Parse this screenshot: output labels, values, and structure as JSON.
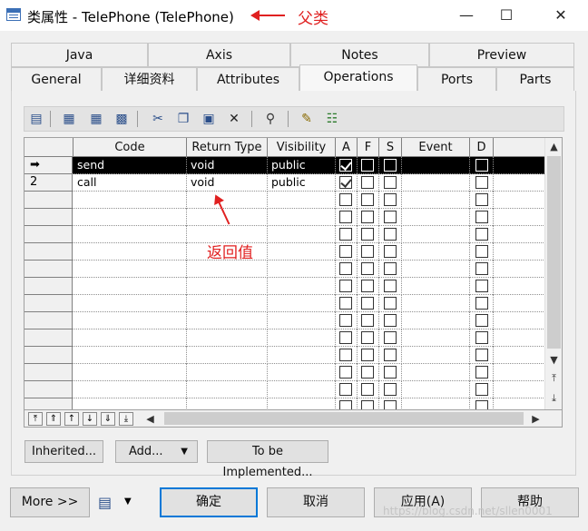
{
  "window": {
    "title": "类属性 - TelePhone (TelePhone)",
    "minimize": "—",
    "maximize": "☐",
    "close": "✕"
  },
  "annotations": {
    "parent_class": "父类",
    "return_value": "返回值"
  },
  "tabs": {
    "row1": [
      {
        "label": "Java"
      },
      {
        "label": "Axis"
      },
      {
        "label": "Notes"
      },
      {
        "label": "Preview"
      }
    ],
    "row2": [
      {
        "label": "General"
      },
      {
        "label": "详细资料"
      },
      {
        "label": "Attributes"
      },
      {
        "label": "Operations"
      },
      {
        "label": "Ports"
      },
      {
        "label": "Parts"
      }
    ],
    "active": "Operations"
  },
  "toolbar": {
    "icons": [
      "properties-icon",
      "add-row-icon",
      "insert-row-icon",
      "grid-view-icon",
      "cut-icon",
      "copy-icon",
      "paste-icon",
      "delete-icon",
      "find-icon",
      "customize-icon",
      "filter-icon"
    ]
  },
  "grid": {
    "headers": {
      "code": "Code",
      "return_type": "Return Type",
      "visibility": "Visibility",
      "a": "A",
      "f": "F",
      "s": "S",
      "event": "Event",
      "d": "D"
    },
    "rows": [
      {
        "num": "➡",
        "code": "send",
        "return_type": "void",
        "visibility": "public",
        "a": true,
        "f": false,
        "s": false,
        "d": false,
        "selected": true
      },
      {
        "num": "2",
        "code": "call",
        "return_type": "void",
        "visibility": "public",
        "a": true,
        "f": false,
        "s": false,
        "d": false,
        "selected": false
      }
    ],
    "empty_rows": 13
  },
  "nav_buttons": [
    "⤒",
    "⇑",
    "↑",
    "↓",
    "⇓",
    "⤓"
  ],
  "buttons": {
    "inherited": "Inherited...",
    "add": "Add...",
    "to_be_implemented": "To be Implemented..."
  },
  "footer": {
    "more": "More >>",
    "ok": "确定",
    "cancel": "取消",
    "apply": "应用(A)",
    "help": "帮助"
  },
  "watermark": "https://blog.csdn.net/sllen0001"
}
